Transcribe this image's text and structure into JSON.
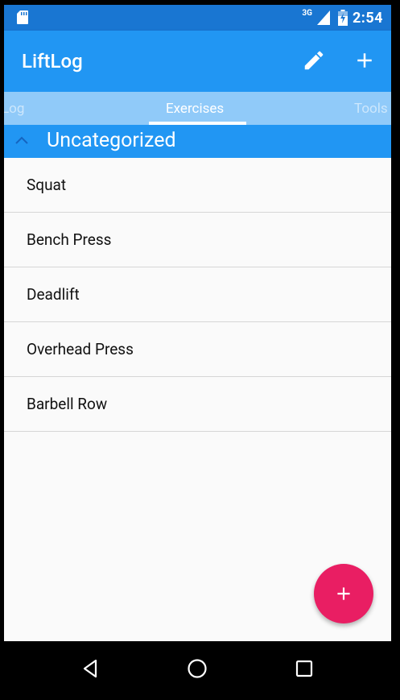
{
  "status_bar": {
    "network": "3G",
    "time": "2:54",
    "icons": [
      "sd-card-icon",
      "signal-icon",
      "battery-icon"
    ]
  },
  "app_bar": {
    "title": "LiftLog",
    "actions": [
      "edit-icon",
      "add-icon"
    ]
  },
  "tabs": [
    {
      "label": "Log",
      "active": false
    },
    {
      "label": "Exercises",
      "active": true
    },
    {
      "label": "Tools",
      "active": false
    }
  ],
  "category": {
    "title": "Uncategorized",
    "expanded": true,
    "icon": "chevron-up-icon"
  },
  "exercises": [
    "Squat",
    "Bench Press",
    "Deadlift",
    "Overhead Press",
    "Barbell Row"
  ],
  "fab": {
    "icon": "add-icon"
  },
  "nav_bar": {
    "buttons": [
      "back-icon",
      "home-icon",
      "recents-icon"
    ]
  },
  "colors": {
    "primary": "#2196f3",
    "primary_dark": "#1976d2",
    "tab_bar": "#90caf9",
    "accent": "#e91e63"
  }
}
